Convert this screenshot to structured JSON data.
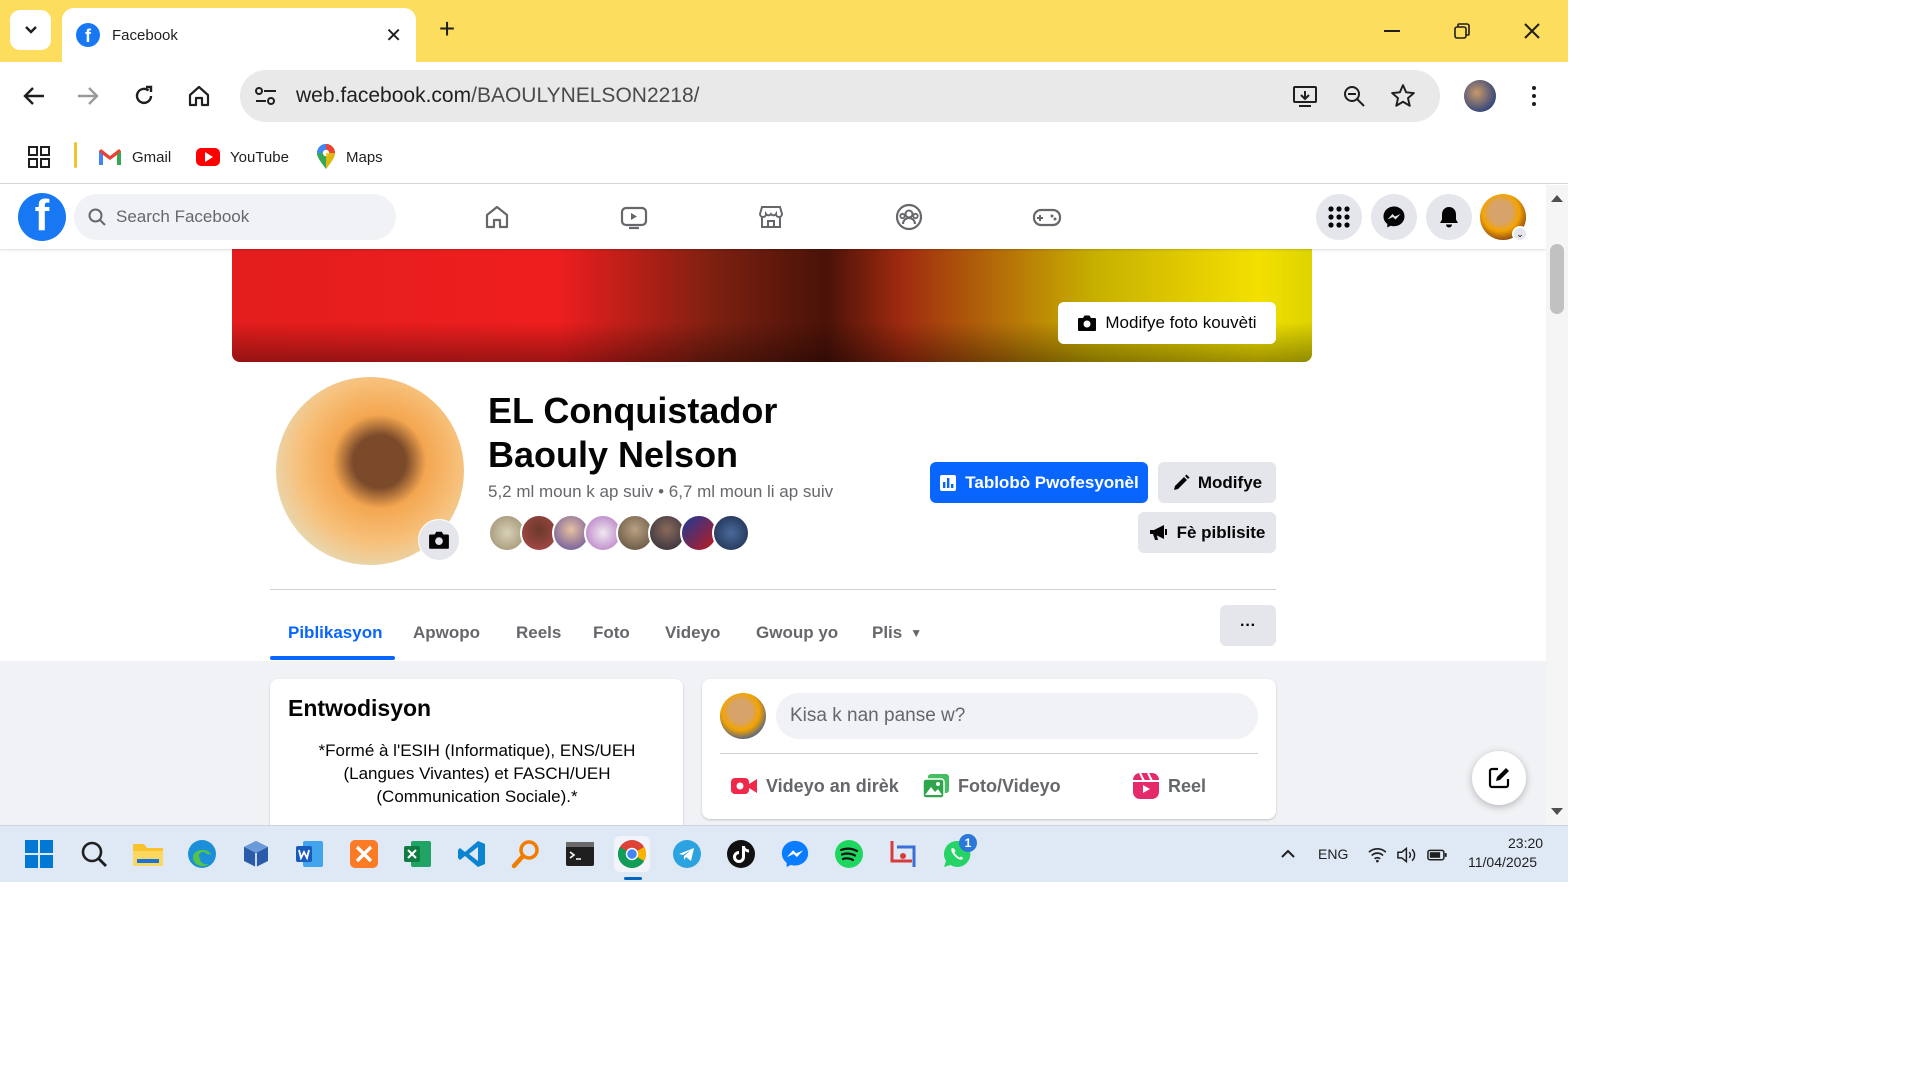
{
  "browser": {
    "tab_title": "Facebook",
    "url_host": "web.facebook.com",
    "url_path": "/BAOULYNELSON2218/",
    "bookmarks": [
      "Gmail",
      "YouTube",
      "Maps"
    ]
  },
  "fb": {
    "search_placeholder": "Search Facebook",
    "nav_icons": [
      "home-icon",
      "video-icon",
      "marketplace-icon",
      "groups-icon",
      "gaming-icon"
    ],
    "right_icons": [
      "menu-grid-icon",
      "messenger-icon",
      "bell-icon"
    ]
  },
  "profile": {
    "cover_button": "Modifye foto kouvèti",
    "name_line1": "EL Conquistador",
    "name_line2": "Baouly Nelson",
    "stats": "5,2 ml moun k ap suiv • 6,7 ml moun li ap suiv",
    "dashboard_button": "Tablobò Pwofesyonèl",
    "edit_button": "Modifye",
    "ads_button": "Fè piblisite",
    "tabs": [
      "Piblikasyon",
      "Apwopo",
      "Reels",
      "Foto",
      "Videyo",
      "Gwoup yo",
      "Plis"
    ],
    "more_button": "···"
  },
  "intro": {
    "title": "Entwodisyon",
    "text": "*Formé à l'ESIH (Informatique), ENS/UEH (Langues Vivantes) et FASCH/UEH (Communication Sociale).*"
  },
  "composer": {
    "placeholder": "Kisa k nan panse w?",
    "actions": [
      "Videyo an dirèk",
      "Foto/Videyo",
      "Reel"
    ]
  },
  "taskbar": {
    "lang": "ENG",
    "time": "23:20",
    "date": "11/04/2025",
    "whatsapp_badge": "1"
  },
  "colors": {
    "tabbar": "#fcdd5d",
    "fb_blue": "#0866ff",
    "fb_bg": "#f0f2f5"
  }
}
